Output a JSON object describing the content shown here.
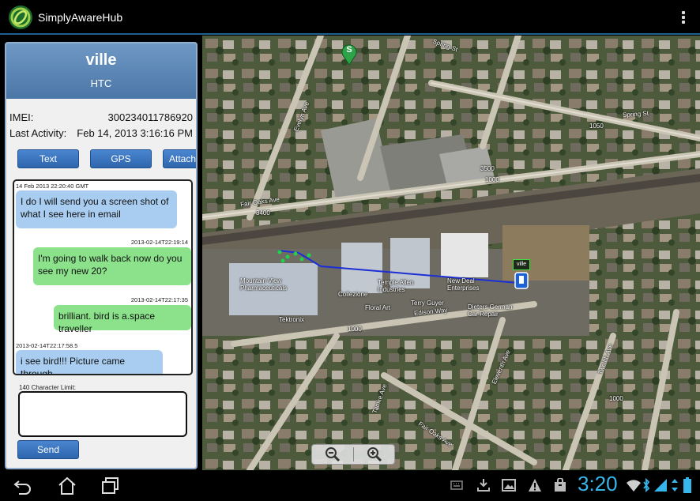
{
  "app": {
    "title": "SimplyAwareHub"
  },
  "contact": {
    "name": "ville",
    "device": "HTC",
    "imei_label": "IMEI:",
    "imei": "300234011786920",
    "last_activity_label": "Last Activity:",
    "last_activity": "Feb 14, 2013 3:16:16 PM"
  },
  "actions": {
    "text": "Text",
    "gps": "GPS",
    "attach": "Attach"
  },
  "chat": {
    "messages": [
      {
        "time": "14 Feb 2013 22:20:40 GMT",
        "text": "I do I will send you a screen shot of what I see here in email",
        "dir": "in"
      },
      {
        "time": "2013-02-14T22:19:14",
        "text": "I'm going to walk back now do you see my new 20?",
        "dir": "out"
      },
      {
        "time": "2013-02-14T22:17:35",
        "text": "brilliant. bird is a.space traveller",
        "dir": "out"
      },
      {
        "time": "2013-02-14T22:17:58.5",
        "text": "i see bird!!! Picture came through",
        "dir": "in"
      }
    ]
  },
  "compose": {
    "limit_label": "140 Character Limit:",
    "value": "",
    "send": "Send"
  },
  "map": {
    "marker_start": "S",
    "marker_user": "ville",
    "streets": [
      "Spring St",
      "Fair Oaks Ave",
      "Evelyn Ave",
      "Edison Way",
      "Fair Oaks Ave",
      "Tamke Ave",
      "Eleventh Ave",
      "Twelfth Ave",
      "Spring St"
    ],
    "places": [
      "Mountain View Pharmaceuticals",
      "Collezione",
      "Temple Allen Industries",
      "Floral Art",
      "Terry Guyer",
      "New Deal Enterprises",
      "Dieters German Car Repair",
      "Tektronix"
    ],
    "numbers": [
      "3400",
      "3500",
      "1000",
      "1050",
      "1000",
      "1000"
    ]
  },
  "status": {
    "clock": "3:20"
  },
  "colors": {
    "accent": "#36b6ea",
    "header": "#4a76a7",
    "bubble_in": "#a9cdf0",
    "bubble_out": "#8be28b"
  }
}
